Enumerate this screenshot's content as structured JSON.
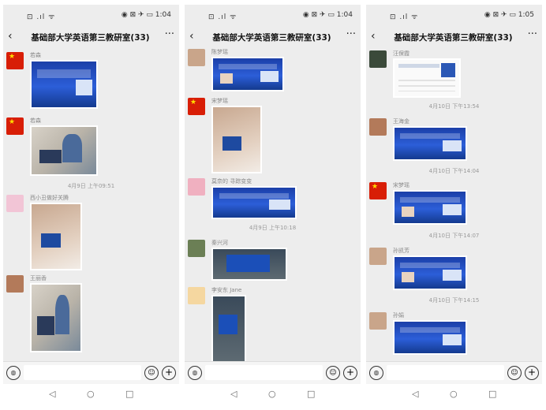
{
  "phones": [
    {
      "status": {
        "left": "⊡ .ıl ᯤ",
        "right": "◉ ⊠ ✈ ▭ 1:04"
      },
      "title": "基础部大学英语第三教研室(33)",
      "messages": [
        {
          "sender": "若森"
        },
        {
          "sender": "若森"
        },
        {
          "time": "4月9日 上午09:51"
        },
        {
          "sender": "西小丑做好关腾"
        },
        {
          "sender": "王丽香"
        }
      ]
    },
    {
      "status": {
        "left": "⊡ .ıl ᯤ",
        "right": "◉ ⊠ ✈ ▭ 1:04"
      },
      "title": "基础部大学英语第三教研室(33)",
      "messages": [
        {
          "sender": "陈梦瑶"
        },
        {
          "sender": "宋梦瑶"
        },
        {
          "sender": "莫奈的 寻踪变变"
        },
        {
          "time": "4月9日 上午10:18"
        },
        {
          "sender": "秦兴河"
        },
        {
          "sender": "李安东 Jane"
        }
      ]
    },
    {
      "status": {
        "left": "⊡ .ıl ᯤ",
        "right": "◉ ⊠ ✈ ▭ 1:05"
      },
      "title": "基础部大学英语第三教研室(33)",
      "messages": [
        {
          "sender": "汪保霞"
        },
        {
          "time": "4月10日 下午13:54"
        },
        {
          "sender": "王海金"
        },
        {
          "time": "4月10日 下午14:04"
        },
        {
          "sender": "宋梦瑶"
        },
        {
          "time": "4月10日 下午14:07"
        },
        {
          "sender": "孙凯芳"
        },
        {
          "time": "4月10日 下午14:15"
        },
        {
          "sender": "孙娟"
        }
      ]
    }
  ],
  "icons": {
    "back": "‹",
    "more": "···",
    "voice": "◍",
    "emoji": "☺",
    "plus": "+",
    "nav_back": "◁",
    "nav_home": "○",
    "nav_recent": "□"
  }
}
